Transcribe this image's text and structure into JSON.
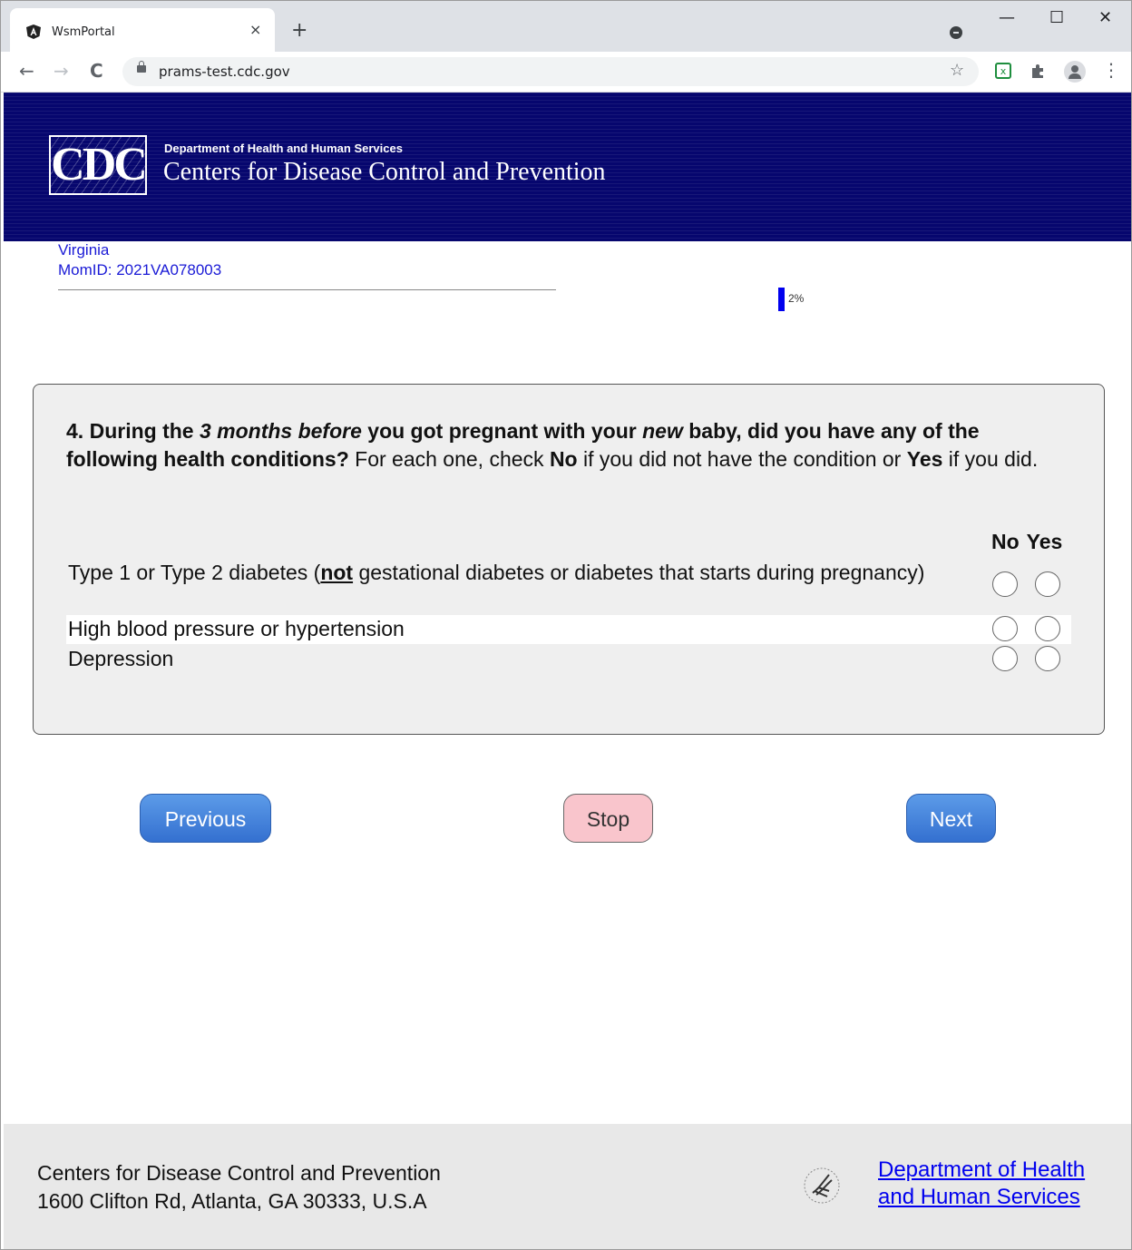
{
  "browser": {
    "tab_title": "WsmPortal",
    "tab_close": "×",
    "new_tab": "+",
    "url": "prams-test.cdc.gov",
    "back": "←",
    "forward": "→",
    "reload": "C",
    "bookmark": "☆",
    "minimize": "—",
    "maximize": "☐",
    "close": "✕",
    "menu": "⋮"
  },
  "header": {
    "logo_text": "CDC",
    "department": "Department of Health and Human Services",
    "agency": "Centers for Disease Control and Prevention"
  },
  "respondent": {
    "state": "Virginia",
    "mom_id": "MomID: 2021VA078003"
  },
  "progress": {
    "percent": 2,
    "label": "2%",
    "fill_color": "#0000ee"
  },
  "question": {
    "number": "4.",
    "part1": "During the",
    "emph1": "3 months before",
    "part2": "you got pregnant with your",
    "emph2": "new",
    "part3": "baby, did you have any of the following health conditions?",
    "instr1": "For each one, check",
    "no_word": "No",
    "instr2": "if you did not have the condition or",
    "yes_word": "Yes",
    "instr3": "if you did.",
    "col_no": "No",
    "col_yes": "Yes",
    "conditions": [
      {
        "pre": "Type 1 or Type 2 diabetes (",
        "strong": "not",
        "post": " gestational diabetes or diabetes that starts during pregnancy)"
      },
      {
        "label": "High blood pressure or hypertension"
      },
      {
        "label": "Depression"
      }
    ]
  },
  "buttons": {
    "previous": "Previous",
    "stop": "Stop",
    "next": "Next"
  },
  "footer": {
    "org": "Centers for Disease Control and Prevention",
    "address": "1600 Clifton Rd, Atlanta, GA 30333, U.S.A",
    "hhs_line1": "Department of Health",
    "hhs_line2": "and Human Services"
  },
  "colors": {
    "header_bg": "#06066e",
    "button_blue": "#3d7ad8",
    "button_stop": "#f9c5cc",
    "link": "#0000ee"
  }
}
